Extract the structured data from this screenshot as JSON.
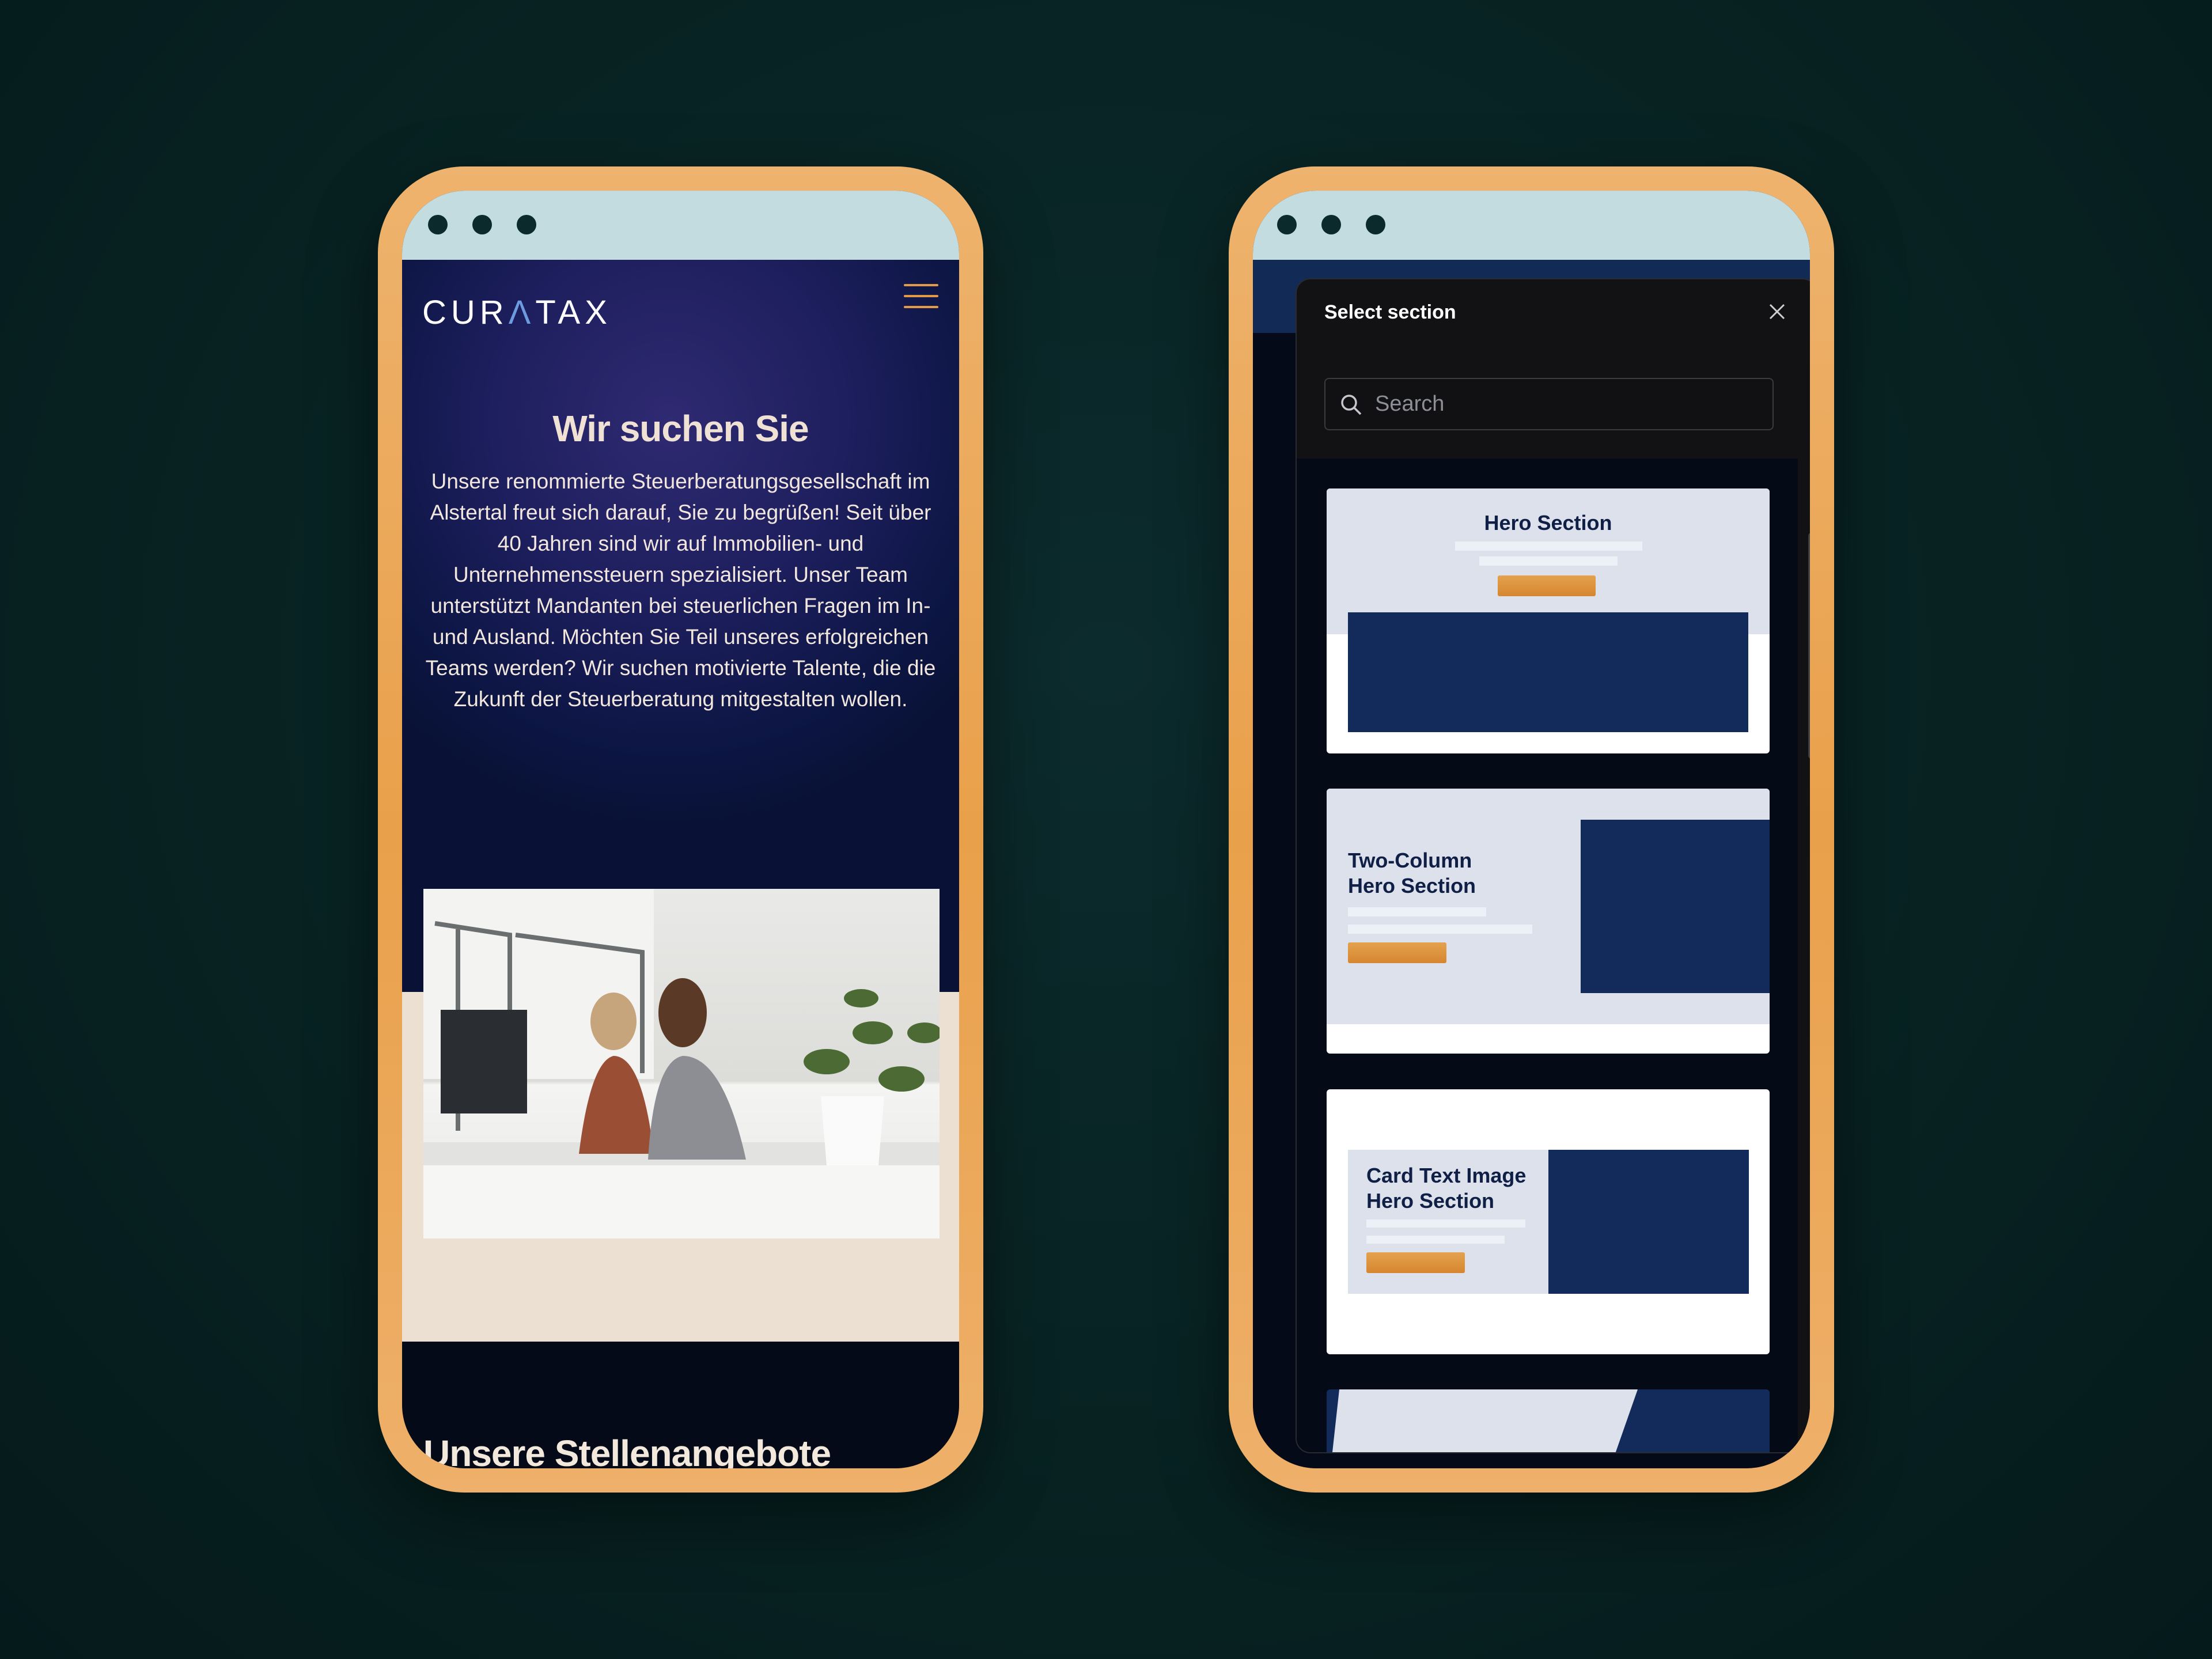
{
  "left_phone": {
    "logo": {
      "part1": "CUR",
      "accent": "Λ",
      "part2": "TAX"
    },
    "menu_icon": "hamburger-icon",
    "hero_title": "Wir suchen Sie",
    "hero_text": "Unsere renommierte Steuerberatungsgesellschaft im Alstertal freut sich darauf, Sie zu begrüßen! Seit über 40 Jahren sind wir auf Immobilien- und Unternehmenssteuern spezialisiert. Unser Team unterstützt Mandanten bei steuerlichen Fragen im In- und Ausland. Möchten Sie Teil unseres erfolgreichen Teams werden? Wir suchen motivierte Talente, die die Zukunft der Steuerberatung mitgestalten wollen.",
    "jobs_heading": "Unsere Stellenangebote"
  },
  "right_phone": {
    "modal_title": "Select section",
    "close_icon": "close-icon",
    "search": {
      "placeholder": "Search",
      "value": ""
    },
    "sections": [
      {
        "label": "Hero Section"
      },
      {
        "label_line1": "Two-Column",
        "label_line2": "Hero Section"
      },
      {
        "label_line1": "Card Text Image",
        "label_line2": "Hero Section"
      }
    ]
  },
  "colors": {
    "frame": "#e9a04a",
    "chrome": "#c2dcdf",
    "navy": "#122b5a",
    "accent_orange": "#d6862e",
    "background": "#082323"
  }
}
